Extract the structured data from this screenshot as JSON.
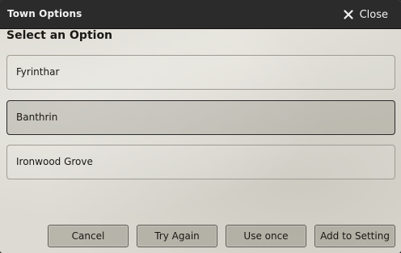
{
  "window": {
    "title": "Town Options",
    "close_label": "Close",
    "close_icon": "close-icon"
  },
  "prompt": {
    "label": "Select an Option"
  },
  "options": [
    {
      "label": "Fyrinthar",
      "selected": false
    },
    {
      "label": "Banthrin",
      "selected": true
    },
    {
      "label": "Ironwood Grove",
      "selected": false
    }
  ],
  "buttons": {
    "cancel": "Cancel",
    "try_again": "Try Again",
    "use_once": "Use once",
    "add_to_setting": "Add to Setting"
  },
  "colors": {
    "titlebar": "#2b2b2b",
    "parchment": "#dcdad2",
    "text": "#191813"
  }
}
